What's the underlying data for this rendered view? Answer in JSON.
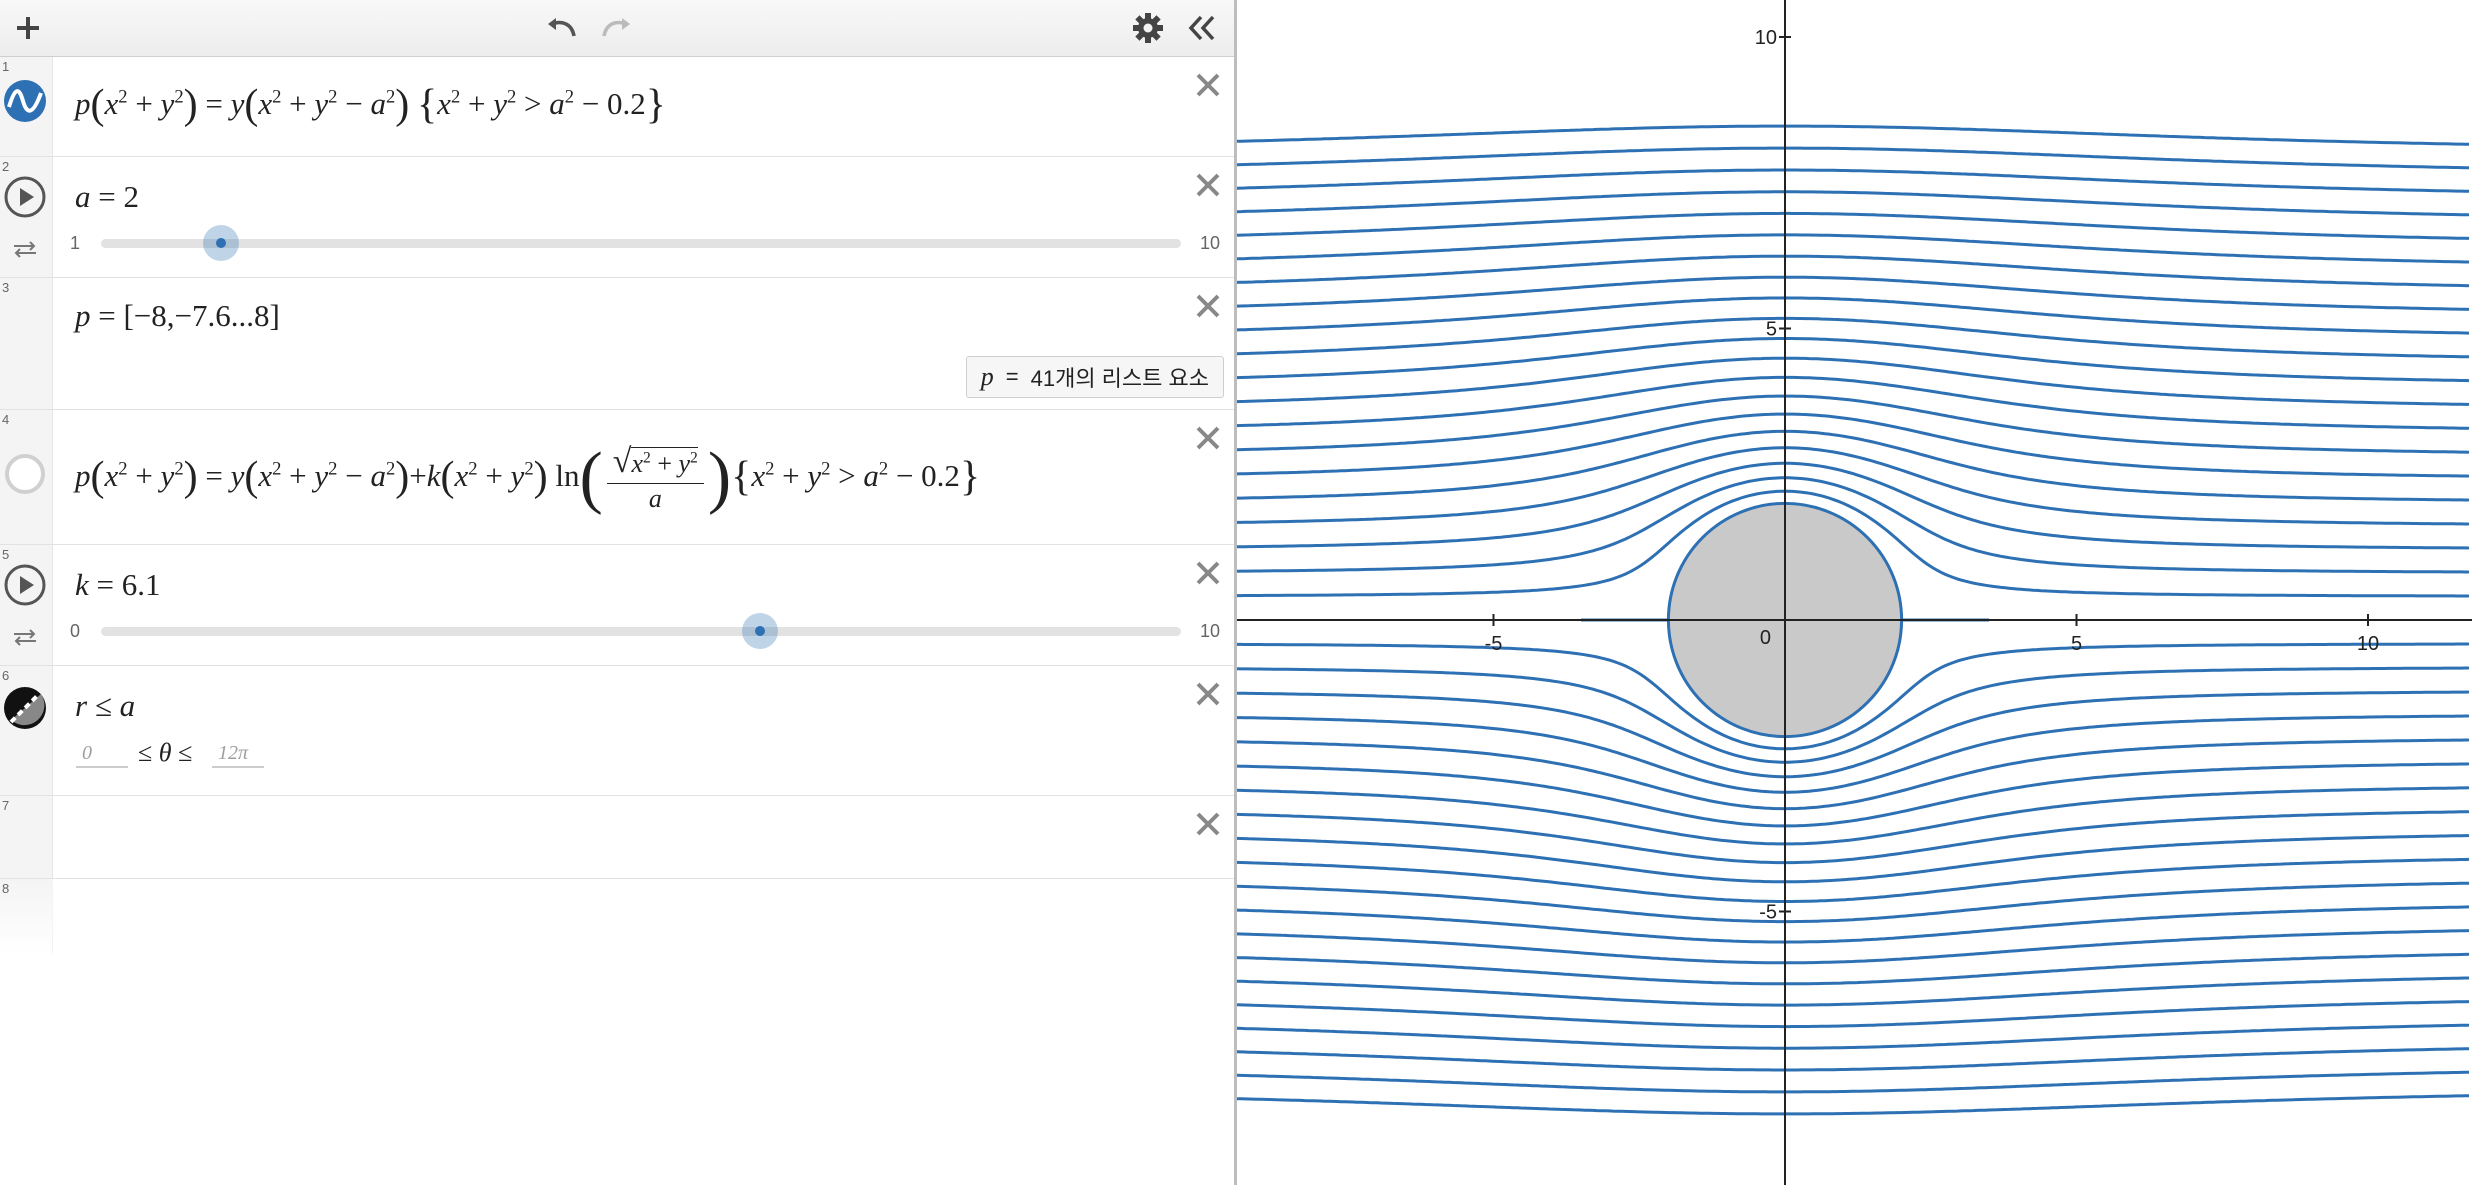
{
  "toolbar": {
    "add_icon": "plus-icon",
    "undo_icon": "undo-icon",
    "redo_icon": "redo-icon",
    "settings_icon": "gear-icon",
    "collapse_icon": "double-chevron-left-icon"
  },
  "expressions": [
    {
      "index": "1",
      "type": "implicit",
      "color": "#2d70b3"
    },
    {
      "index": "2",
      "type": "slider",
      "variable": "a",
      "value": "2",
      "min": "1",
      "max": "10",
      "fraction": 0.111
    },
    {
      "index": "3",
      "type": "list",
      "variable": "p",
      "list_text": "[−8,−7.6...8]",
      "tooltip_var": "p",
      "tooltip_eq": "=",
      "tooltip_text": "41개의 리스트 요소"
    },
    {
      "index": "4",
      "type": "implicit",
      "color": "#2d70b3",
      "hidden": true
    },
    {
      "index": "5",
      "type": "slider",
      "variable": "k",
      "value": "6.1",
      "min": "0",
      "max": "10",
      "fraction": 0.61
    },
    {
      "index": "6",
      "type": "polar",
      "text": "r ≤ a",
      "theta_min": "0",
      "theta_max": "12π",
      "color": "#000000"
    },
    {
      "index": "7",
      "type": "empty"
    },
    {
      "index": "8",
      "type": "empty"
    }
  ],
  "graph": {
    "x_ticks": [
      "-5",
      "0",
      "5",
      "10"
    ],
    "y_ticks": [
      "10",
      "5",
      "-5"
    ],
    "curve_color": "#2d70b3",
    "disk_fill": "#c9c9c9",
    "a": 2,
    "p_start": -8,
    "p_step": 0.4,
    "p_count": 41,
    "x_range": [
      -9.3,
      11.5
    ],
    "y_range": [
      -9.5,
      10.5
    ]
  }
}
